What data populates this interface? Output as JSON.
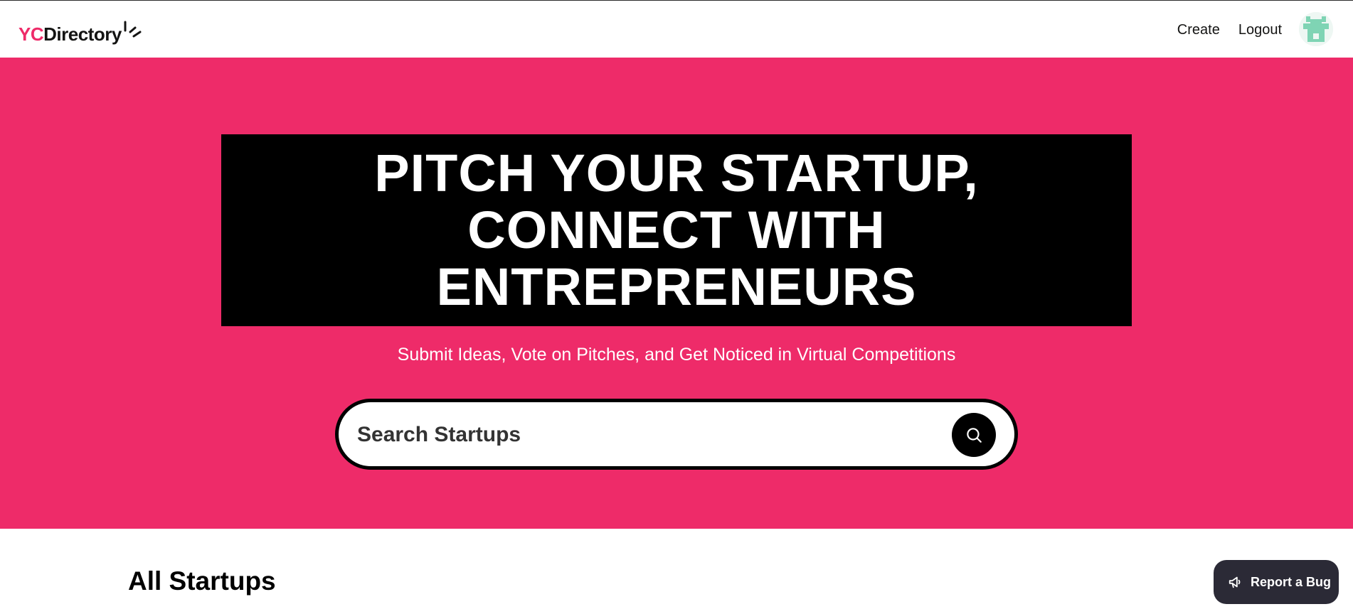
{
  "navbar": {
    "logo": {
      "part1": "YC",
      "part2": "Directory"
    },
    "links": {
      "create": "Create",
      "logout": "Logout"
    },
    "avatar_icon": "user-avatar-icon"
  },
  "hero": {
    "heading": "Pitch Your Startup, Connect With Entrepreneurs",
    "subheading": "Submit Ideas, Vote on Pitches, and Get Noticed in Virtual Competitions",
    "search": {
      "placeholder": "Search Startups",
      "value": "",
      "button_icon": "search-icon"
    }
  },
  "section": {
    "title": "All Startups"
  },
  "report_bug": {
    "label": "Report a Bug",
    "icon": "megaphone-icon"
  },
  "colors": {
    "brand_pink": "#EE2B69",
    "black": "#000000",
    "white": "#FFFFFF",
    "bug_button_bg": "#2B2A36"
  }
}
